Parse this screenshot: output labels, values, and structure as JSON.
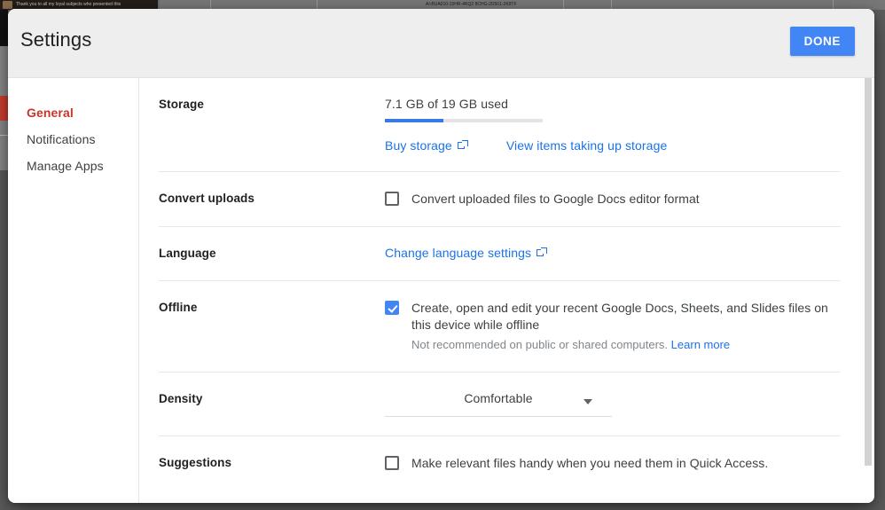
{
  "backdrop": {
    "caption": "Thank you to all my loyal subjects who presented this",
    "doc_text": "AI-BUA010-15HR-4RQ2 8CHG-2D501-2K9TF"
  },
  "dialog": {
    "title": "Settings",
    "done_label": "DONE",
    "accent_color": "#4285f4",
    "link_color": "#1a73e8",
    "active_nav_color": "#c5372c"
  },
  "sidebar": {
    "items": [
      {
        "label": "General",
        "active": true
      },
      {
        "label": "Notifications",
        "active": false
      },
      {
        "label": "Manage Apps",
        "active": false
      }
    ]
  },
  "sections": {
    "storage": {
      "label": "Storage",
      "used_text": "7.1 GB of 19 GB used",
      "used_percent": 37,
      "buy_link": "Buy storage",
      "view_link": "View items taking up storage"
    },
    "convert_uploads": {
      "label": "Convert uploads",
      "checkbox_label": "Convert uploaded files to Google Docs editor format",
      "checked": false
    },
    "language": {
      "label": "Language",
      "link": "Change language settings"
    },
    "offline": {
      "label": "Offline",
      "checkbox_label": "Create, open and edit your recent Google Docs, Sheets, and Slides files on this device while offline",
      "checked": true,
      "sub_text": "Not recommended on public or shared computers.",
      "sub_link": "Learn more"
    },
    "density": {
      "label": "Density",
      "selected": "Comfortable"
    },
    "suggestions": {
      "label": "Suggestions",
      "checkbox_label": "Make relevant files handy when you need them in Quick Access.",
      "checked": false
    }
  }
}
